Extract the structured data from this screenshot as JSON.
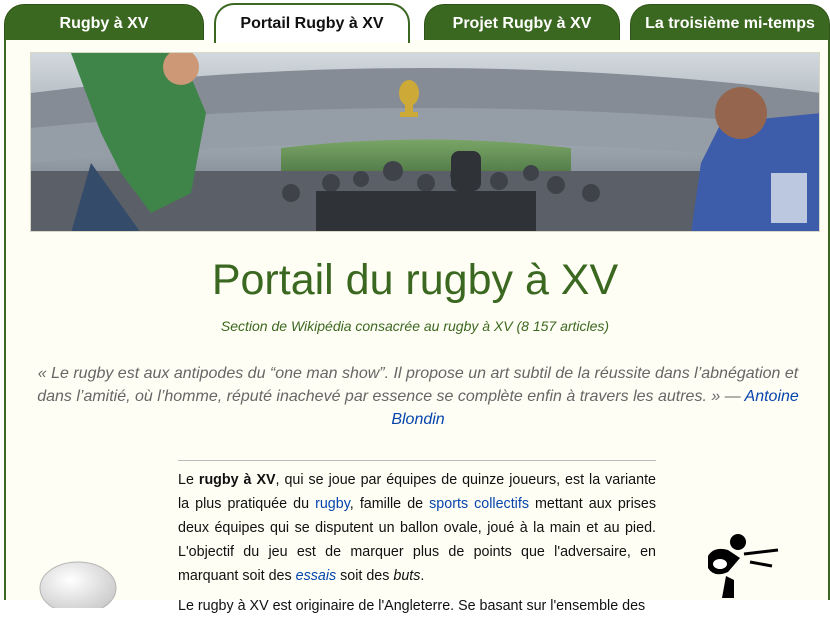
{
  "tabs": [
    {
      "label": "Rugby à XV"
    },
    {
      "label": "Portail Rugby à XV"
    },
    {
      "label": "Projet Rugby à XV"
    },
    {
      "label": "La troisième mi-temps"
    }
  ],
  "portal": {
    "title": "Portail du rugby à XV",
    "subtitle": "Section de Wikipédia consacrée au rugby à XV (8 157 articles)"
  },
  "quote": {
    "text": "« Le rugby est aux antipodes du “one man show”. Il propose un art subtil de la réussite dans l’abnégation et dans l’amitié, où l’homme, réputé inachevé par essence se complète enfin à travers les autres. » — ",
    "author": "Antoine Blondin"
  },
  "intro": {
    "p1_a": "Le ",
    "p1_b": "rugby à XV",
    "p1_c": ", qui se joue par équipes de quinze joueurs, est la variante la plus pratiquée du ",
    "link_rugby": "rugby",
    "p1_d": ", famille de ",
    "link_sports": "sports collectifs",
    "p1_e": " mettant aux prises deux équipes qui se disputent un ballon ovale, joué à la main et au pied. L'objectif du jeu est de marquer plus de points que l'adversaire, en marquant soit des ",
    "link_essais": "essais",
    "p1_f": " soit des ",
    "buts": "buts",
    "p1_g": ".",
    "p2": "Le rugby à XV est originaire de l'Angleterre. Se basant sur l'ensemble des"
  },
  "colors": {
    "accent": "#3b6820",
    "link": "#0645ad",
    "background": "#fffef4"
  }
}
